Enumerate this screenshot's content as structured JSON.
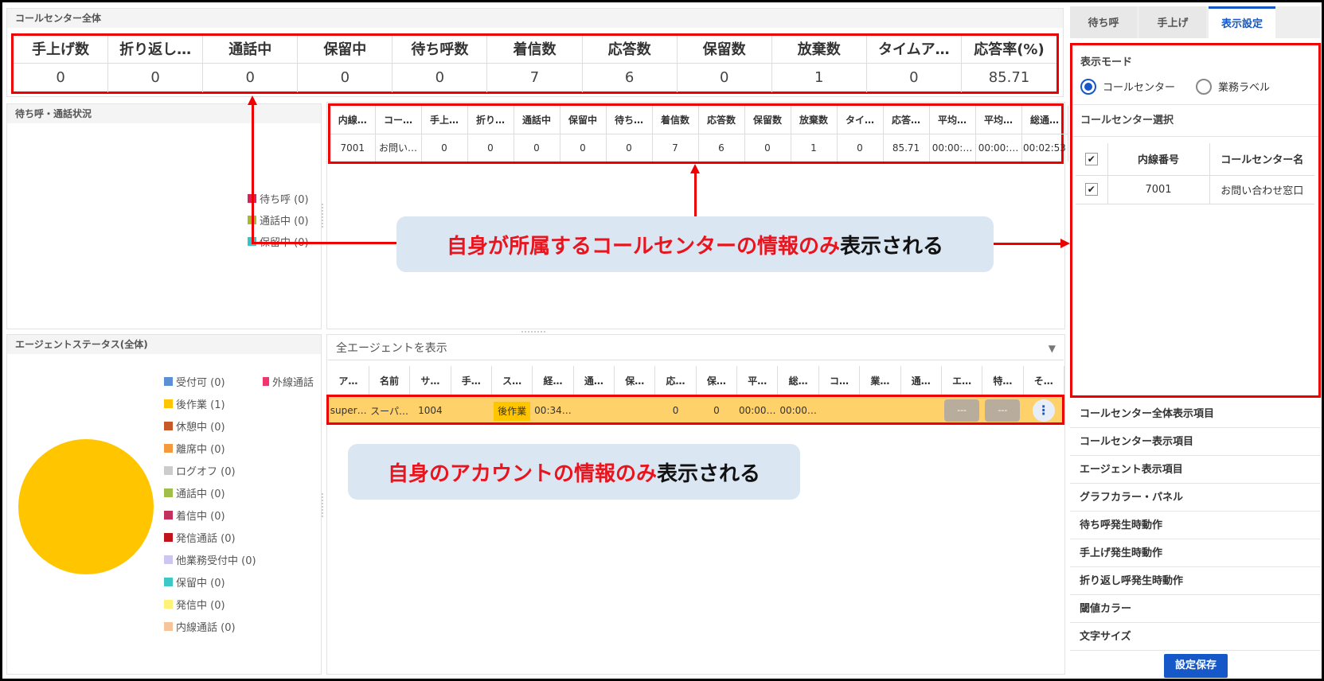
{
  "summary": {
    "title": "コールセンター全体",
    "headers": [
      "手上げ数",
      "折り返し…",
      "通話中",
      "保留中",
      "待ち呼数",
      "着信数",
      "応答数",
      "保留数",
      "放棄数",
      "タイムア…",
      "応答率(%)"
    ],
    "values": [
      "0",
      "0",
      "0",
      "0",
      "0",
      "7",
      "6",
      "0",
      "1",
      "0",
      "85.71"
    ]
  },
  "waiting": {
    "title": "待ち呼・通話状況",
    "legend": [
      {
        "label": "待ち呼 (0)",
        "color": "#d9215a"
      },
      {
        "label": "通話中 (0)",
        "color": "#a8b92a"
      },
      {
        "label": "保留中 (0)",
        "color": "#33c6c6"
      }
    ]
  },
  "center_table": {
    "headers": [
      "内線…",
      "コー…",
      "手上…",
      "折り…",
      "通話中",
      "保留中",
      "待ち…",
      "着信数",
      "応答数",
      "保留数",
      "放棄数",
      "タイ…",
      "応答…",
      "平均…",
      "平均…",
      "総通…"
    ],
    "row": [
      "7001",
      "お問い…",
      "0",
      "0",
      "0",
      "0",
      "0",
      "7",
      "6",
      "0",
      "1",
      "0",
      "85.71",
      "00:00:…",
      "00:00:…",
      "00:02:53"
    ]
  },
  "callout1": {
    "red": "自身が所属するコールセンターの情報のみ",
    "black": "表示される"
  },
  "callout2": {
    "red": "自身のアカウントの情報のみ",
    "black": "表示される"
  },
  "agent_status": {
    "title": "エージェントステータス(全体)",
    "legend": [
      {
        "label": "受付可 (0)",
        "color": "#5b8fd6"
      },
      {
        "label": "後作業 (1)",
        "color": "#ffc600"
      },
      {
        "label": "休憩中 (0)",
        "color": "#c8582a"
      },
      {
        "label": "離席中 (0)",
        "color": "#f39a3b"
      },
      {
        "label": "ログオフ (0)",
        "color": "#cccccc"
      },
      {
        "label": "通話中 (0)",
        "color": "#a0be4a"
      },
      {
        "label": "着信中 (0)",
        "color": "#c2305e"
      },
      {
        "label": "発信通話 (0)",
        "color": "#c0141c"
      },
      {
        "label": "他業務受付中 (0)",
        "color": "#cdc6f0"
      },
      {
        "label": "保留中 (0)",
        "color": "#3cc8c8"
      },
      {
        "label": "発信中 (0)",
        "color": "#fff27a"
      },
      {
        "label": "内線通話 (0)",
        "color": "#f7c49a"
      }
    ],
    "legend_extra": {
      "label": "外線通話",
      "color": "#f0366a"
    },
    "pie_color": "#ffc600"
  },
  "agent_filter": {
    "label": "全エージェントを表示"
  },
  "agent_table": {
    "headers": [
      "ア…",
      "名前",
      "サ…",
      "手…",
      "ス…",
      "経…",
      "通…",
      "保…",
      "応…",
      "保…",
      "平…",
      "総…",
      "コ…",
      "業…",
      "通…",
      "エ…",
      "特…",
      "そ…"
    ],
    "row": [
      "super…",
      "スーパ…",
      "1004",
      "",
      "後作業",
      "00:34…",
      "",
      "",
      "0",
      "0",
      "00:00…",
      "00:00…",
      "",
      "",
      "",
      "---",
      "---",
      "⋮"
    ]
  },
  "right_panel": {
    "tabs": [
      "待ち呼",
      "手上げ",
      "表示設定"
    ],
    "display_mode_label": "表示モード",
    "mode_options": [
      "コールセンター",
      "業務ラベル"
    ],
    "center_select_label": "コールセンター選択",
    "select_headers": [
      "内線番号",
      "コールセンター名"
    ],
    "select_row": [
      "7001",
      "お問い合わせ窓口"
    ],
    "menu": [
      "コールセンター全体表示項目",
      "コールセンター表示項目",
      "エージェント表示項目",
      "グラフカラー・パネル",
      "待ち呼発生時動作",
      "手上げ発生時動作",
      "折り返し呼発生時動作",
      "閾値カラー",
      "文字サイズ"
    ],
    "save_label": "設定保存"
  }
}
